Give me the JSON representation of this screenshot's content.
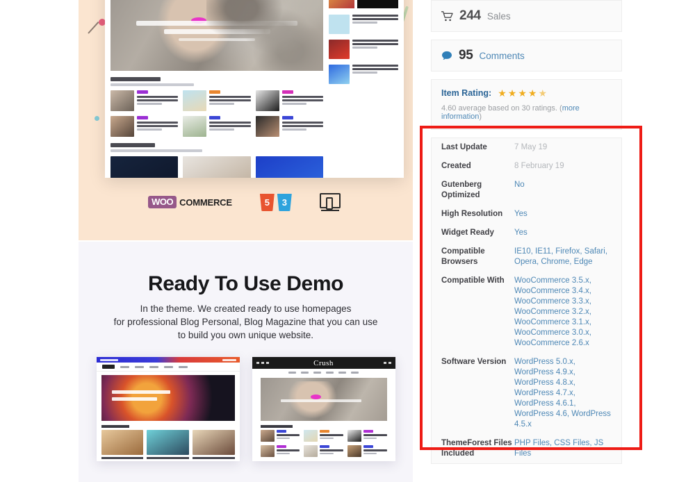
{
  "preview": {
    "badges": {
      "woocommerce_mark": "WOO",
      "woocommerce_word": "COMMERCE",
      "html5_label": "5",
      "css3_label": "3",
      "responsive_name": "responsive-icon"
    },
    "demo": {
      "title": "Ready To Use Demo",
      "description_line1": "In the theme. We created ready to use homepages",
      "description_line2": "for professional Blog Personal, Blog Magazine that you can use",
      "description_line3": "to build you own unique website."
    },
    "thumbnails": [
      {
        "name": "demo-thumbnail-blog",
        "brand": ""
      },
      {
        "name": "demo-thumbnail-crush",
        "brand": "Crush"
      }
    ]
  },
  "sidebar": {
    "sales": {
      "count": "244",
      "label": "Sales",
      "icon": "cart-icon"
    },
    "comments": {
      "count": "95",
      "label": "Comments",
      "icon": "comment-bubble-icon"
    },
    "rating": {
      "label": "Item Rating:",
      "stars_full": 4,
      "stars_half": 1,
      "stars_total": 5,
      "summary_prefix": "4.60 average based on 30 ratings.",
      "more_info_open": "(",
      "more_info_link": "more information",
      "more_info_close": ")",
      "star_color": "#f0ad20",
      "link_color": "#4d87b5"
    },
    "attributes": [
      {
        "key": "Last Update",
        "values": [
          "7 May 19"
        ],
        "muted": true
      },
      {
        "key": "Created",
        "values": [
          "8 February 19"
        ],
        "muted": true
      },
      {
        "key": "Gutenberg Optimized",
        "values": [
          "No"
        ],
        "muted": false
      },
      {
        "key": "High Resolution",
        "values": [
          "Yes"
        ],
        "muted": false
      },
      {
        "key": "Widget Ready",
        "values": [
          "Yes"
        ],
        "muted": false
      },
      {
        "key": "Compatible Browsers",
        "values": [
          "IE10, IE11, Firefox, Safari,",
          "Opera, Chrome, Edge"
        ],
        "muted": false
      },
      {
        "key": "Compatible With",
        "values": [
          "WooCommerce 3.5.x,",
          "WooCommerce 3.4.x,",
          "WooCommerce 3.3.x,",
          "WooCommerce 3.2.x,",
          "WooCommerce 3.1.x,",
          "WooCommerce 3.0.x,",
          "WooCommerce 2.6.x"
        ],
        "muted": false
      },
      {
        "key": "Software Version",
        "values": [
          "WordPress 5.0.x,",
          "WordPress 4.9.x,",
          "WordPress 4.8.x,",
          "WordPress 4.7.x,",
          "WordPress 4.6.1,",
          "WordPress 4.6, WordPress",
          "4.5.x"
        ],
        "muted": false
      },
      {
        "key": "ThemeForest Files Included",
        "values": [
          "PHP Files, CSS Files, JS",
          "Files"
        ],
        "muted": false
      }
    ]
  },
  "annotation": {
    "highlight_color": "#ee1c16",
    "name": "red-highlight-rectangle"
  },
  "colors": {
    "peach_panel": "#fbe5d0",
    "lavender_panel": "#f6f5fa",
    "card_bg": "#fafafa",
    "card_border": "#ededed"
  }
}
